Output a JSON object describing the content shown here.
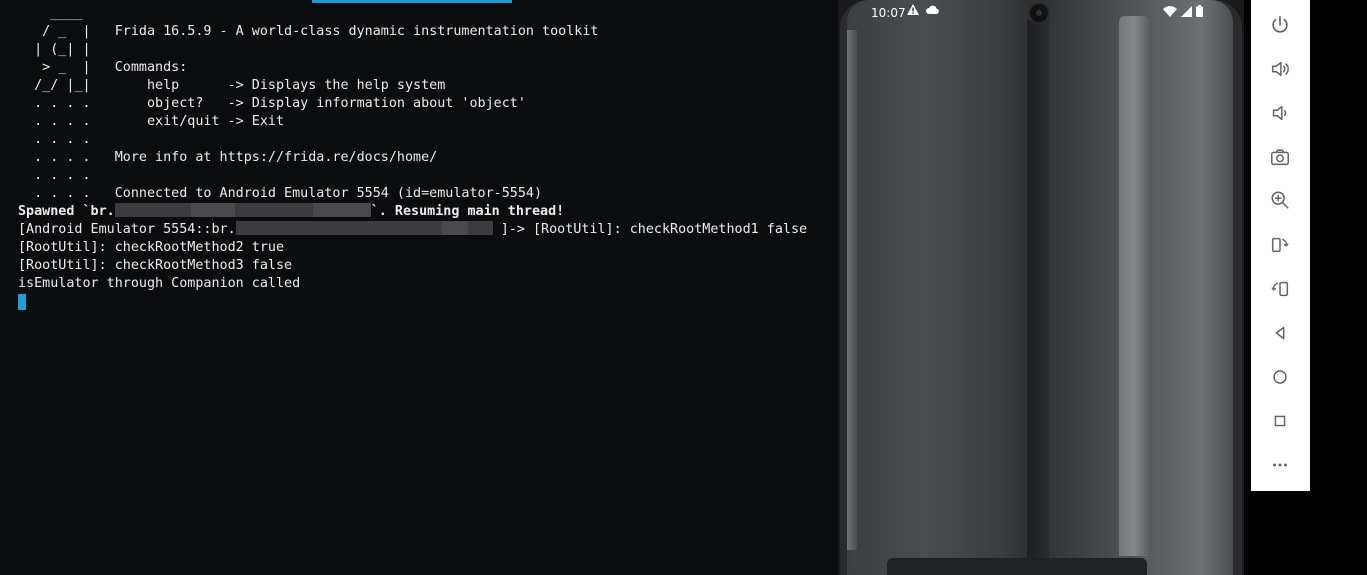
{
  "terminal": {
    "ascii": [
      "    ____",
      "   / _  |",
      "  | (_| |",
      "   > _  |",
      "  /_/ |_|",
      "  . . . .",
      "  . . . .",
      "  . . . .",
      "  . . . .",
      "  . . . ."
    ],
    "banner": "Frida 16.5.9 - A world-class dynamic instrumentation toolkit",
    "commands_label": "Commands:",
    "cmd_help": "    help      -> Displays the help system",
    "cmd_object": "    object?   -> Display information about 'object'",
    "cmd_exit": "    exit/quit -> Exit",
    "more_info": "More info at https://frida.re/docs/home/",
    "connected": "Connected to Android Emulator 5554 (id=emulator-5554)",
    "spawned_prefix": "Spawned `br.",
    "spawned_suffix": "`. Resuming main thread!",
    "log1_prefix": "[Android Emulator 5554::br.",
    "log1_suffix": " ]-> [RootUtil]: checkRootMethod1 false",
    "log2": "[RootUtil]: checkRootMethod2 true",
    "log3": "[RootUtil]: checkRootMethod3 false",
    "log4": "isEmulator through Companion called"
  },
  "phone": {
    "time": "10:07",
    "status_left_icons": [
      "warning-icon",
      "cloud-icon"
    ],
    "status_right_icons": [
      "wifi-icon",
      "signal-icon",
      "battery-icon"
    ]
  },
  "toolbar": {
    "buttons": [
      "power",
      "volume-up",
      "volume-down",
      "screenshot",
      "zoom",
      "rotate-left",
      "rotate-right",
      "back",
      "home",
      "overview",
      "more"
    ]
  },
  "colors": {
    "accent": "#1e98d4",
    "terminal_bg": "#0b0c0d",
    "toolbar_bg": "#ffffff",
    "icon": "#5f6368"
  }
}
